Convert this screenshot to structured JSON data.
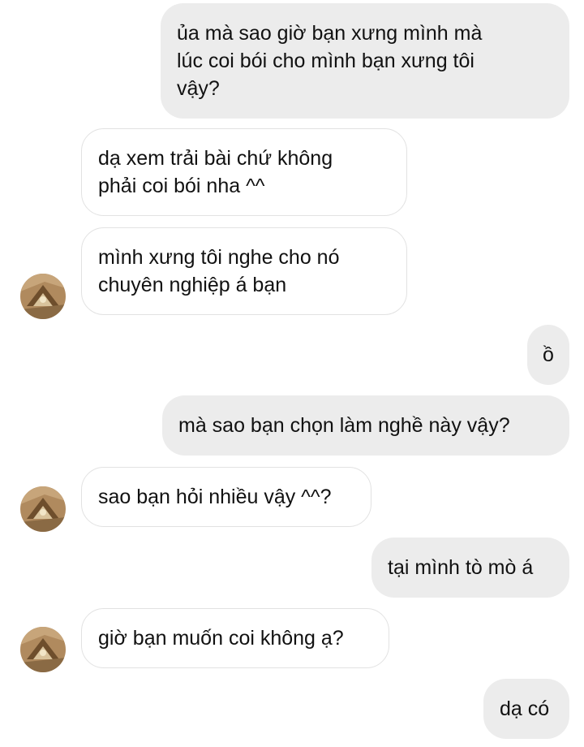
{
  "conversation": {
    "messages": [
      {
        "from": "me",
        "text": "ủa mà sao giờ bạn xưng mình mà\nlúc coi bói cho mình bạn xưng tôi\nvậy?"
      },
      {
        "from": "them",
        "text": "dạ xem trải bài chứ không\nphải coi bói nha ^^"
      },
      {
        "from": "them",
        "text": "mình xưng tôi nghe cho nó\nchuyên nghiệp á bạn"
      },
      {
        "from": "me",
        "text": "ồ"
      },
      {
        "from": "me",
        "text": "mà sao bạn chọn làm nghề này vậy?"
      },
      {
        "from": "them",
        "text": "sao bạn hỏi nhiều vậy ^^?"
      },
      {
        "from": "me",
        "text": "tại mình tò mò á"
      },
      {
        "from": "them",
        "text": "giờ bạn muốn coi không ạ?"
      },
      {
        "from": "me",
        "text": "dạ có"
      }
    ]
  },
  "colors": {
    "sent_bubble": "#ececec",
    "received_bubble": "#ffffff",
    "received_border": "#e2e2e2",
    "text": "#111111"
  },
  "icons": {
    "avatar": "contact-avatar-photo"
  }
}
